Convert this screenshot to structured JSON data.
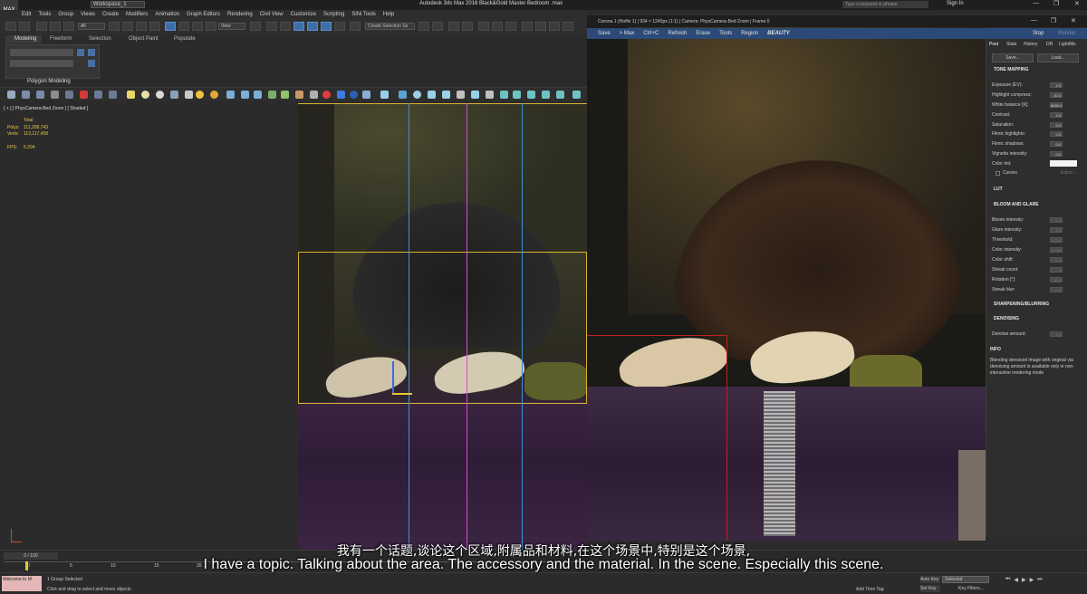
{
  "app": {
    "title": "Autodesk 3ds Max 2016     Black&Gold Master Bedroom .max",
    "workspace": "Workspace_1",
    "search_placeholder": "Type a keyword or phrase",
    "sign_in": "Sign In",
    "logo": "MAX"
  },
  "menu": [
    "Edit",
    "Tools",
    "Group",
    "Views",
    "Create",
    "Modifiers",
    "Animation",
    "Graph Editors",
    "Rendering",
    "Civil View",
    "Customize",
    "Scripting",
    "SiNi Tools",
    "Help"
  ],
  "toolbar": {
    "filter_all": "All",
    "view": "View",
    "selection_set": "Create Selection Se"
  },
  "ribbon": {
    "tabs": [
      "Modeling",
      "Freeform",
      "Selection",
      "Object Paint",
      "Populate"
    ],
    "panel_label": "Polygon Modeling"
  },
  "viewport": {
    "label": "[ + ] [ PhysCamera-Bed Zoom ] [ Shaded ]",
    "stats": {
      "total": "Total",
      "polys_label": "Polys:",
      "polys": "111,208,743",
      "verts_label": "Verts:",
      "verts": "113,117,458",
      "fps_label": "FPS:",
      "fps": "5.294"
    }
  },
  "corona": {
    "header": "Corona 1 (Hotfix 1) | 934 × 1245px (1:1) | Camera: PhysCamera-Bed Zoom | Frame 0",
    "toolbar": [
      "Save",
      "> Max",
      "Ctrl+C",
      "Refresh",
      "Erase",
      "Tools",
      "Region",
      "BEAUTY"
    ],
    "right_toolbar": [
      "Stop",
      "Render"
    ],
    "panel_tabs": [
      "Post",
      "Stats",
      "History",
      "DR",
      "LightMix"
    ],
    "save": "Save...",
    "load": "Load...",
    "tone_mapping": "TONE MAPPING",
    "tone_params": [
      {
        "label": "Exposure (EV):",
        "value": "2.0"
      },
      {
        "label": "Highlight compress:",
        "value": "10.0"
      },
      {
        "label": "White balance [K]:",
        "value": "6000.0"
      },
      {
        "label": "Contrast:",
        "value": "2.0"
      },
      {
        "label": "Saturation:",
        "value": "0.0"
      },
      {
        "label": "Filmic highlights:",
        "value": "0.0"
      },
      {
        "label": "Filmic shadows:",
        "value": "0.0"
      },
      {
        "label": "Vignette intensity:",
        "value": "0.0"
      },
      {
        "label": "Color tint:",
        "value": ""
      }
    ],
    "curves": "Curves",
    "curves_editor": "Editor...",
    "lut": "LUT",
    "bloom": "BLOOM AND GLARE",
    "bloom_params": [
      {
        "label": "Bloom intensity:",
        "value": "1.0"
      },
      {
        "label": "Glare intensity:",
        "value": "1.0"
      },
      {
        "label": "Threshold:",
        "value": "0.750"
      },
      {
        "label": "Color intensity:",
        "value": "0.150"
      },
      {
        "label": "Color shift:",
        "value": "0.0"
      },
      {
        "label": "Streak count:",
        "value": "3"
      },
      {
        "label": "Rotation [°]:",
        "value": "15.0"
      },
      {
        "label": "Streak blur:",
        "value": "0.2"
      }
    ],
    "sharpening": "SHARPENING/BLURRING",
    "denoising": "DENOISING",
    "denoise_label": "Denoise amount:",
    "denoise_value": "1.0",
    "info": "INFO",
    "info_text": "Blending denoised image with original via denoising amount is available only in non-interactive rendering mode"
  },
  "timeline": {
    "frame": "0 / 100",
    "ticks": [
      "0",
      "5",
      "10",
      "15",
      "20"
    ]
  },
  "status": {
    "welcome": "Welcome to M",
    "group_selected": "1 Group Selected",
    "hint": "Click and drag to select and move objects",
    "add_time_tag": "Add Time Tag",
    "auto_key": "Auto Key",
    "selected": "Selected",
    "set_key": "Set Key",
    "key_filters": "Key Filters..."
  },
  "subtitles": {
    "cn": "我有一个话题,谈论这个区域,附属品和材料,在这个场景中,特别是这个场景,",
    "en": "I have a topic. Talking about the area. The accessory and the material. In the scene. Especially this scene."
  }
}
